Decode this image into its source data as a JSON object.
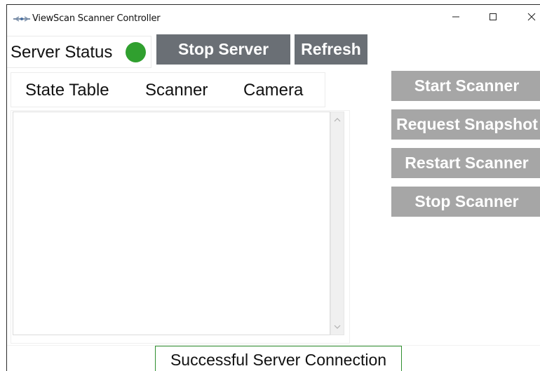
{
  "window": {
    "title": "ViewScan Scanner Controller"
  },
  "server": {
    "status_label": "Server Status",
    "status_color": "#30a02f",
    "stop_label": "Stop Server",
    "refresh_label": "Refresh"
  },
  "tabs": [
    {
      "label": "State Table"
    },
    {
      "label": "Scanner"
    },
    {
      "label": "Camera"
    }
  ],
  "scanner_controls": {
    "start_label": "Start Scanner",
    "snapshot_label": "Request Snapshot",
    "restart_label": "Restart Scanner",
    "stop_label": "Stop Scanner"
  },
  "status_bar": {
    "message": "Successful Server Connection"
  },
  "colors": {
    "dark_button": "#6a6f75",
    "disabled_button": "#a6a6a6",
    "status_border": "#2f8f2f"
  }
}
